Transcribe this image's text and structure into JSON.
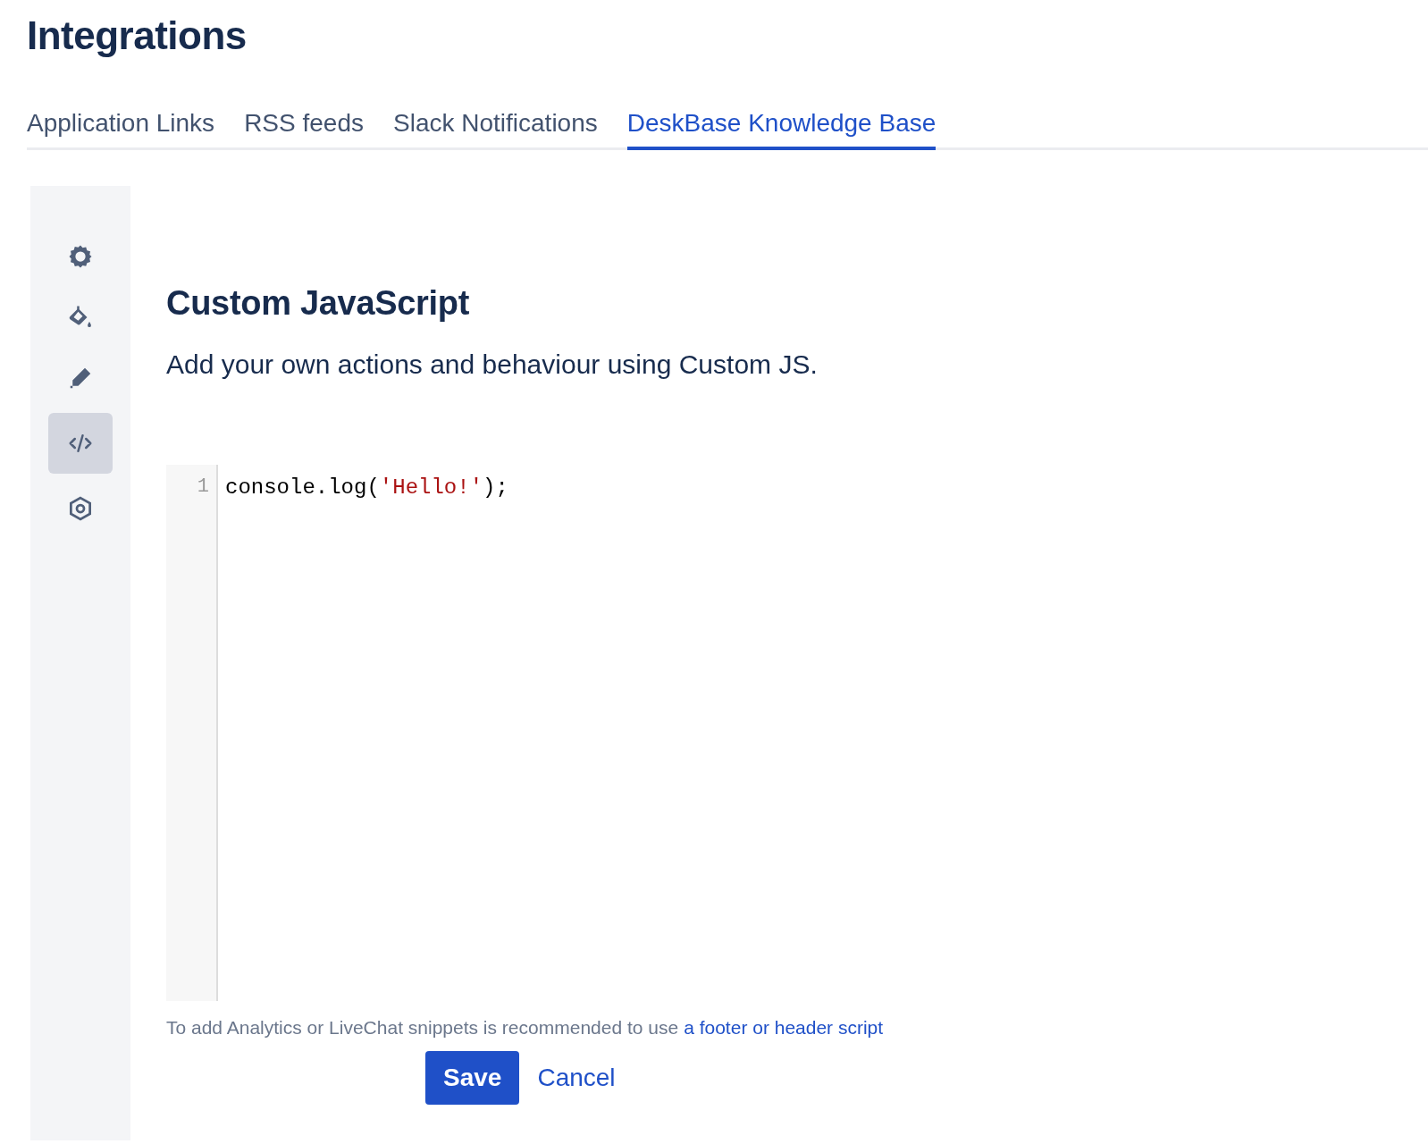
{
  "page": {
    "title": "Integrations"
  },
  "tabs": [
    {
      "label": "Application Links",
      "selected": false
    },
    {
      "label": "RSS feeds",
      "selected": false
    },
    {
      "label": "Slack Notifications",
      "selected": false
    },
    {
      "label": "DeskBase Knowledge Base",
      "selected": true
    }
  ],
  "sidebar": {
    "items": [
      {
        "selected": false
      },
      {
        "selected": false
      },
      {
        "selected": false
      },
      {
        "selected": true
      },
      {
        "selected": false
      }
    ]
  },
  "section": {
    "heading": "Custom JavaScript",
    "description": "Add your own actions and behaviour using Custom JS."
  },
  "editor": {
    "lines": [
      {
        "number": "1",
        "tokens": [
          {
            "text": "console.log(",
            "kind": "plain"
          },
          {
            "text": "'Hello!'",
            "kind": "string"
          },
          {
            "text": ");",
            "kind": "plain"
          }
        ]
      }
    ]
  },
  "hint": {
    "text": "To add Analytics or LiveChat snippets is recommended to use",
    "link": "a footer or header script"
  },
  "buttons": [
    {
      "label": "Save",
      "kind": "primary"
    },
    {
      "label": "Cancel",
      "kind": "link"
    }
  ]
}
